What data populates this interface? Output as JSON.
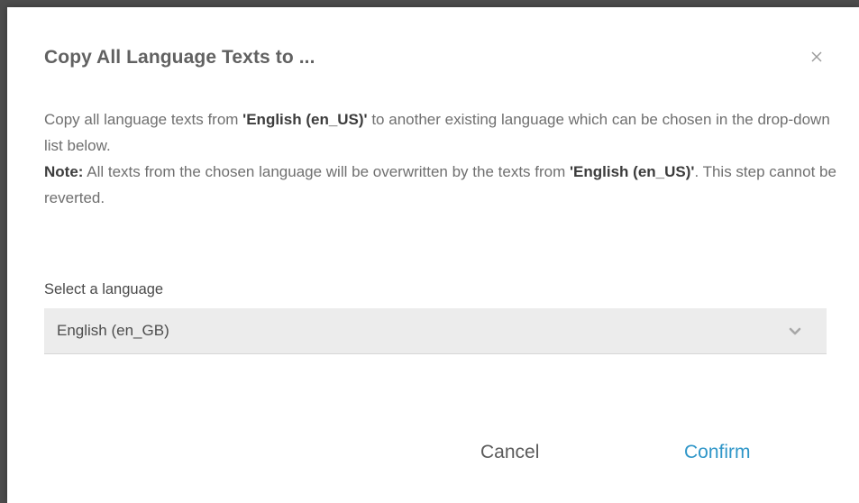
{
  "dialog": {
    "title": "Copy All Language Texts to ...",
    "desc_part1": "Copy all language texts from ",
    "source_lang": "'English (en_US)'",
    "desc_part2": " to another existing language which can be chosen in the drop-down list below.",
    "note_label": "Note:",
    "note_part1": " All texts from the chosen language will be overwritten by the texts from ",
    "note_source_lang": "'English (en_US)'",
    "note_part2": ". This step cannot be reverted.",
    "select_label": "Select a language",
    "selected_language": "English (en_GB)",
    "cancel_label": "Cancel",
    "confirm_label": "Confirm",
    "accent_color": "#2f96c8"
  }
}
